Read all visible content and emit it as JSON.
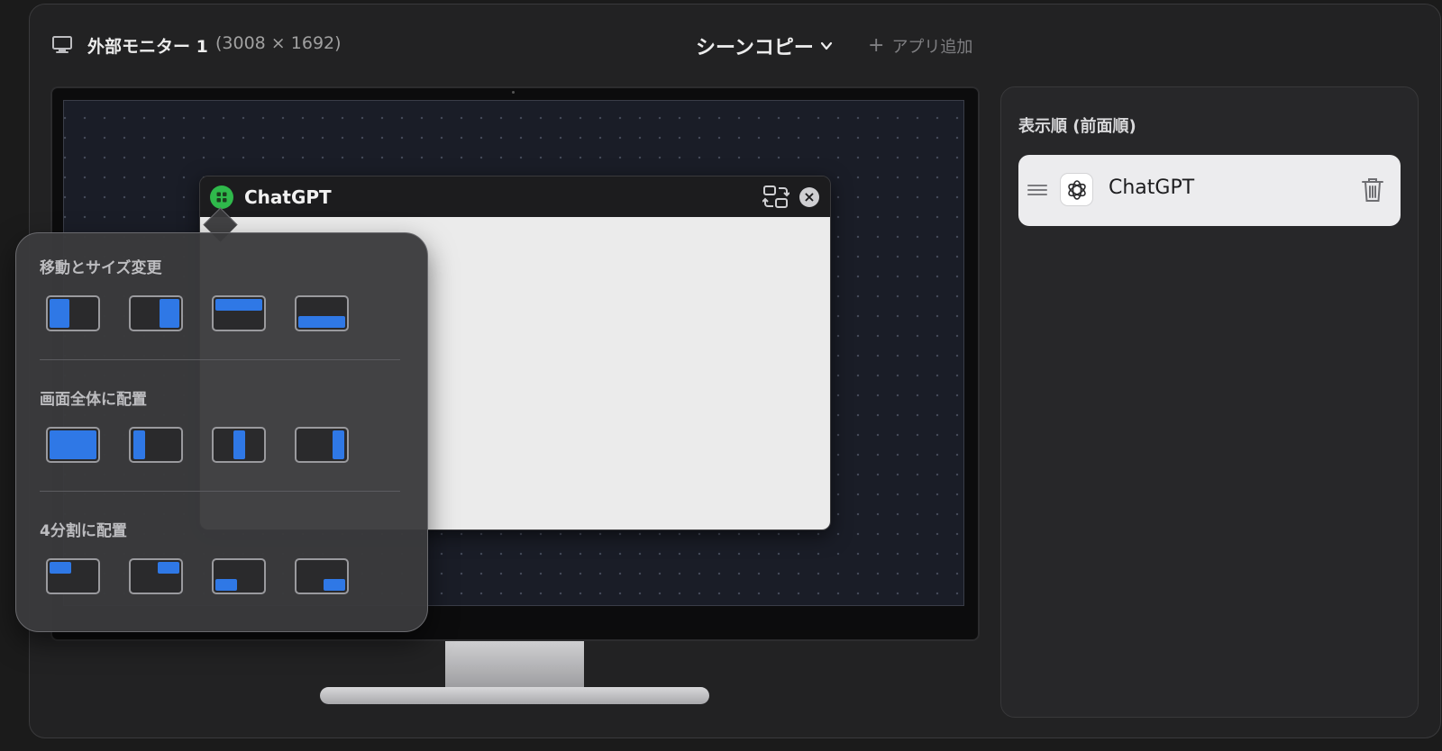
{
  "header": {
    "monitor_icon": "display-icon",
    "title": "外部モニター 1",
    "resolution": "(3008 × 1692)",
    "scene_menu_label": "シーンコピー",
    "add_app_label": "アプリ追加"
  },
  "window": {
    "app_name": "ChatGPT",
    "badge_icon": "grid-icon",
    "swap_icon": "swap-screen-icon",
    "close_glyph": "×"
  },
  "popover": {
    "sections": [
      {
        "title": "移動とサイズ変更",
        "tiles": [
          "left-half",
          "right-half",
          "top-half",
          "bottom-half"
        ]
      },
      {
        "title": "画面全体に配置",
        "tiles": [
          "fill",
          "left-column",
          "center-column",
          "right-column"
        ]
      },
      {
        "title": "4分割に配置",
        "tiles": [
          "top-left",
          "top-right",
          "bottom-left",
          "bottom-right"
        ]
      }
    ]
  },
  "sidebar": {
    "title": "表示順 (前面順)",
    "items": [
      {
        "label": "ChatGPT",
        "icon": "openai-logo-icon"
      }
    ]
  },
  "colors": {
    "accent": "#2f78e6",
    "badge_green": "#2fb94b",
    "background": "#222223"
  }
}
